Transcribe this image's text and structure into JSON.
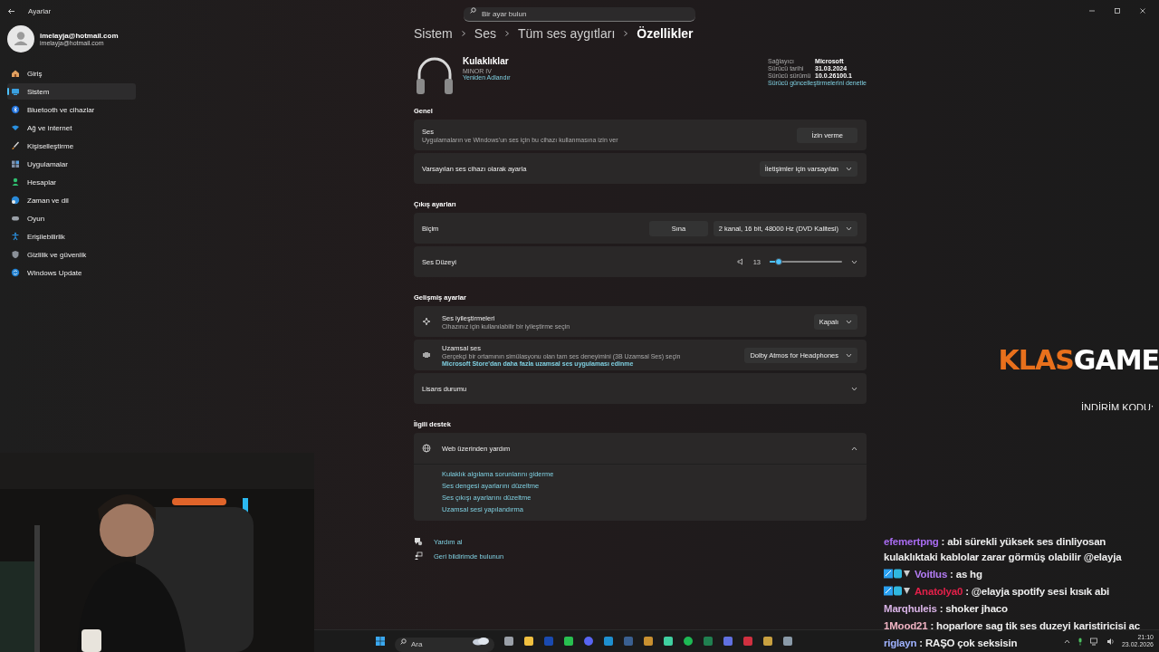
{
  "window": {
    "title": "Ayarlar"
  },
  "search": {
    "placeholder": "Bir ayar bulun"
  },
  "account": {
    "name": "imelayja@hotmail.com",
    "email": "imelayja@hotmail.com"
  },
  "sidebar": {
    "items": [
      {
        "kind": "home",
        "label": "Giriş",
        "selected": false
      },
      {
        "kind": "system",
        "label": "Sistem",
        "selected": true
      },
      {
        "kind": "bluetooth",
        "label": "Bluetooth ve cihazlar",
        "selected": false
      },
      {
        "kind": "network",
        "label": "Ağ ve internet",
        "selected": false
      },
      {
        "kind": "personalize",
        "label": "Kişiselleştirme",
        "selected": false
      },
      {
        "kind": "apps",
        "label": "Uygulamalar",
        "selected": false
      },
      {
        "kind": "accounts",
        "label": "Hesaplar",
        "selected": false
      },
      {
        "kind": "time",
        "label": "Zaman ve dil",
        "selected": false
      },
      {
        "kind": "gaming",
        "label": "Oyun",
        "selected": false
      },
      {
        "kind": "accessibility",
        "label": "Erişilebilirlik",
        "selected": false
      },
      {
        "kind": "privacy",
        "label": "Gizlilik ve güvenlik",
        "selected": false
      },
      {
        "kind": "update",
        "label": "Windows Update",
        "selected": false
      }
    ]
  },
  "breadcrumb": [
    "Sistem",
    "Ses",
    "Tüm ses aygıtları",
    "Özellikler"
  ],
  "device": {
    "name": "Kulaklıklar",
    "model": "MINOR IV",
    "rename_link": "Yeniden Adlandır"
  },
  "driver": {
    "rows": [
      {
        "label": "Sağlayıcı",
        "value": "Microsoft"
      },
      {
        "label": "Sürücü tarihi",
        "value": "31.03.2024"
      },
      {
        "label": "Sürücü sürümü",
        "value": "10.0.26100.1"
      }
    ],
    "link": "Sürücü güncelleştirmelerini denetle"
  },
  "sections": [
    {
      "title": "Genel",
      "cards": [
        {
          "kind": "button",
          "title": "Ses",
          "subtitle": "Uygulamaların ve Windows'un ses için bu cihazı kullanmasına izin ver",
          "button": "İzin verme"
        },
        {
          "kind": "dropdown",
          "title": "Varsayılan ses cihazı olarak ayarla",
          "value": "İletişimler için varsayılan"
        }
      ]
    },
    {
      "title": "Çıkış ayarları",
      "cards": [
        {
          "kind": "format",
          "title": "Biçim",
          "button": "Sına",
          "value": "2 kanal, 16 bit, 48000 Hz (DVD Kalitesi)"
        },
        {
          "kind": "volume",
          "title": "Ses Düzeyi",
          "reading": "13",
          "level": 0.13,
          "expanded": false
        }
      ]
    },
    {
      "title": "Gelişmiş ayarlar",
      "cards": [
        {
          "kind": "dropdown",
          "title": "Ses iyileştirmeleri",
          "subtitle": "Cihazınız için kullanılabilir bir iyileştirme seçin",
          "value": "Kapalı"
        },
        {
          "kind": "dropdown",
          "title": "Uzamsal ses",
          "subtitle": "Gerçekçi bir ortamının simülasyonu olan tam ses deneyimini (3B Uzamsal Ses) seçin",
          "link": "Microsoft Store'dan daha fazla uzamsal ses uygulaması edinme",
          "value": "Dolby Atmos for Headphones"
        },
        {
          "kind": "expander",
          "title": "Lisans durumu",
          "expanded": false
        }
      ]
    },
    {
      "title": "İlgili destek",
      "cards": [
        {
          "kind": "expander",
          "title": "Web üzerinden yardım",
          "expanded": true,
          "links": [
            "Kulaklık algılama sorunlarını giderme",
            "Ses dengesi ayarlarını düzeltme",
            "Ses çıkışı ayarlarını düzeltme",
            "Uzamsal sesi yapılandırma"
          ]
        }
      ]
    }
  ],
  "footer_links": [
    {
      "kind": "help",
      "label": "Yardım al"
    },
    {
      "kind": "feedback",
      "label": "Geri bildirimde bulunun"
    }
  ],
  "overlay": {
    "logo": {
      "part_1": "KLAS",
      "part_2": "GAME"
    },
    "promo": "İNDİRİM KODU:"
  },
  "chat": [
    {
      "user": "efemertpng",
      "color": "#a86bf0",
      "badges": false,
      "message": ": abi sürekli yüksek ses dinliyosan kulaklıktaki kablolar zarar görmüş olabilir @elayja"
    },
    {
      "user": "Voitlus",
      "color": "#b47cf5",
      "badges": true,
      "message": ": as hg"
    },
    {
      "user": "Anatolya0",
      "color": "#e3204a",
      "badges": true,
      "message": ": @elayja spotify sesi kısık abi"
    },
    {
      "user": "Marqhuleis",
      "color": "#d9b3e6",
      "badges": false,
      "message": ": shoker jhaco"
    },
    {
      "user": "1Mood21",
      "color": "#f0b3c3",
      "badges": false,
      "message": ": hoparlore sag tik ses duzeyi karistiricisi ac"
    },
    {
      "user": "riglayn",
      "color": "#9fb2ff",
      "badges": false,
      "message": ": RAŞO çok seksisin"
    }
  ],
  "taskbar": {
    "search_placeholder": "Ara",
    "time": "21:10",
    "date": "23.02.2026"
  }
}
